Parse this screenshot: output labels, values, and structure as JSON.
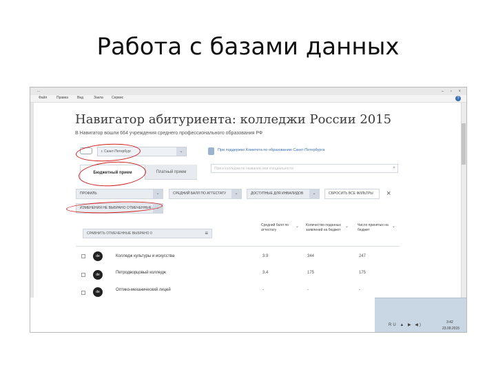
{
  "slide": {
    "title": "Работа с базами данных"
  },
  "window": {
    "title": "...",
    "controls": "– ▫ ×"
  },
  "menu": [
    "Файл",
    "Правка",
    "Вид",
    "Закла",
    "Сервис"
  ],
  "page": {
    "title": "Навигатор абитуриента: колледжи России 2015",
    "subtitle": "В Навигатор вошли 664 учреждения среднего профессионального образования РФ",
    "city": "г. Санкт-Петербург",
    "gov_link": "При поддержке Комитета по образованию Санкт-Петербурга",
    "tabs": {
      "budget": "Бюджетный прием",
      "paid": "Платный прием"
    },
    "search_placeholder": "Поиск колледжа по названию или специальности",
    "filters": {
      "profile": "ПРОФИЛЬ",
      "avg_score": "СРЕДНИЙ БАЛЛ ПО АТТЕСТАТУ",
      "accessible": "ДОСТУПНЫЕ ДЛЯ ИНВАЛИДОВ",
      "reset": "СБРОСИТЬ ВСЕ ФИЛЬТРЫ",
      "noted": "ИЗМЕНЕНИЯ НЕ ВЫБРАНО ОТМЕЧЕННЫЕ (0)"
    },
    "table": {
      "compare": "СРАВНИТЬ ОТМЕЧЕННЫЕ ВЫБРАНО 0",
      "headers": {
        "score": "Средний балл по аттестату",
        "apps": "Количество поданных заявлений на бюджет",
        "places": "Число принятых на бюджет"
      },
      "rows": [
        {
          "name": "Колледж культуры и искусства",
          "score": "3.9",
          "apps": "344",
          "places": "247"
        },
        {
          "name": "Петродворцовый колледж",
          "score": "3.4",
          "apps": "175",
          "places": "175"
        },
        {
          "name": "Оптико-механический лицей",
          "score": "-",
          "apps": "-",
          "places": "-"
        }
      ]
    }
  },
  "taskbar": {
    "tray": "RU ▲ ▶ ◀)",
    "time": "3:42",
    "date": "23.09.2015"
  }
}
